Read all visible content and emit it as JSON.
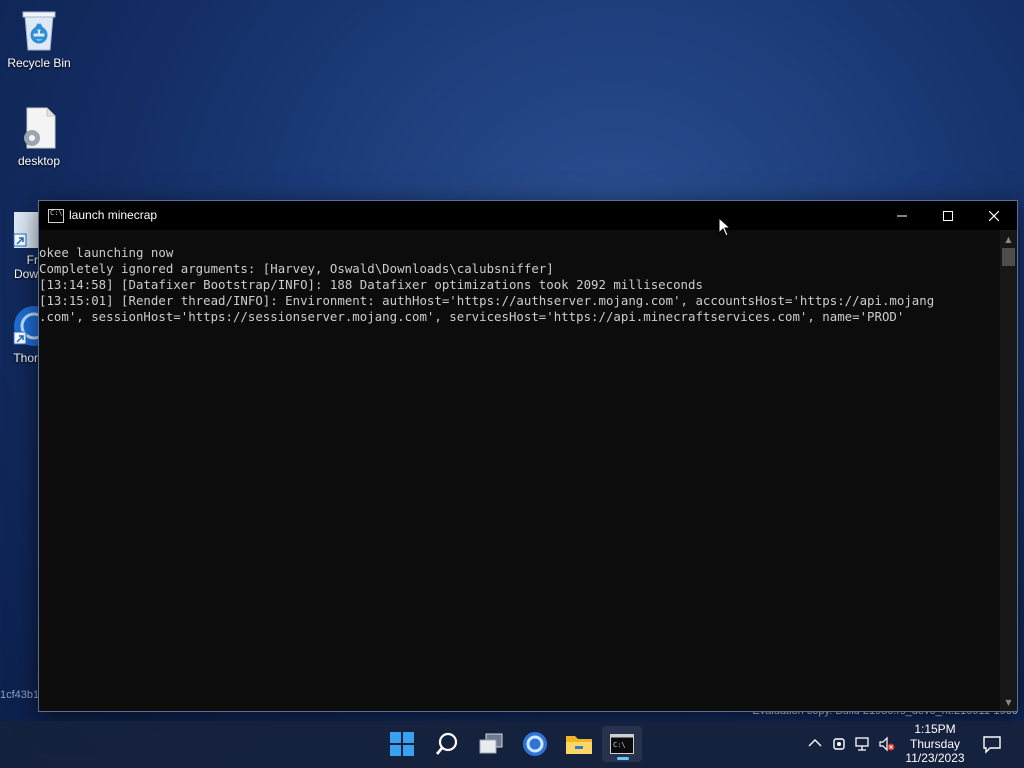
{
  "desktop": {
    "icons": [
      {
        "label": "Recycle Bin",
        "icon": "recycle-bin-icon"
      },
      {
        "label": "desktop",
        "icon": "settings-file-icon"
      }
    ],
    "partial_icons": [
      {
        "label_line1": "Fr",
        "label_line2": "Dow"
      },
      {
        "label_line1": "Thor"
      }
    ],
    "hash_text": "1cf43b1",
    "watermark": "Evaluation copy. Build 21980.rs_dev0_rlt.210911-1900"
  },
  "window": {
    "title": "launch minecrap",
    "controls": {
      "minimize": "─",
      "maximize": "☐",
      "close": "✕"
    },
    "console_lines": [
      "okee launching now",
      "Completely ignored arguments: [Harvey, Oswald\\Downloads\\calubsniffer]",
      "[13:14:58] [Datafixer Bootstrap/INFO]: 188 Datafixer optimizations took 2092 milliseconds",
      "[13:15:01] [Render thread/INFO]: Environment: authHost='https://authserver.mojang.com', accountsHost='https://api.mojang",
      ".com', sessionHost='https://sessionserver.mojang.com', servicesHost='https://api.minecraftservices.com', name='PROD'"
    ]
  },
  "taskbar": {
    "apps": [
      {
        "name": "start",
        "icon": "windows-start-icon"
      },
      {
        "name": "search",
        "icon": "search-icon"
      },
      {
        "name": "task-view",
        "icon": "task-view-icon"
      },
      {
        "name": "browser",
        "icon": "browser-icon"
      },
      {
        "name": "file-explorer",
        "icon": "folder-icon"
      },
      {
        "name": "terminal",
        "icon": "terminal-icon",
        "active": true
      }
    ],
    "clock": {
      "time": "1:15PM",
      "day": "Thursday",
      "date": "11/23/2023"
    }
  },
  "colors": {
    "accent": "#6cc7ff",
    "console_text": "#cccccc",
    "console_bg": "#0c0c0c"
  }
}
